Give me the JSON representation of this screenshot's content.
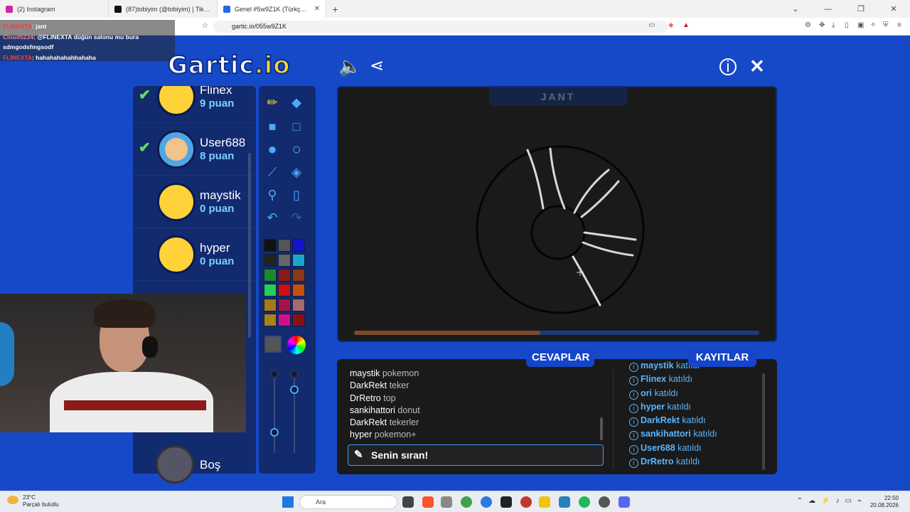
{
  "browser": {
    "tabs": [
      {
        "title": "(2) Instagram",
        "color": "#d6249f"
      },
      {
        "title": "(87)tobiyim (@tobiyim) | TikTok",
        "color": "#111111"
      },
      {
        "title": "Genel #5w9Z1K (Türkçe) - Gartic",
        "color": "#1f6ae0",
        "active": true
      }
    ],
    "url": "gartic.io/055w9Z1K"
  },
  "stream_chat": [
    {
      "user": "FLINEXTA",
      "text": ": jant"
    },
    {
      "user": "Cloud5234",
      "text": ": @FLINEXTA düğün salonu mu bura"
    },
    {
      "user": "",
      "text": "sdmgodsfmgsodf"
    },
    {
      "user": "FLINEXTA",
      "text": ": hahahahahahhahaha"
    }
  ],
  "logo": {
    "main": "Gartic",
    "suffix": ".io"
  },
  "players": [
    {
      "name": "Flinex",
      "points": "9 puan",
      "checked": true
    },
    {
      "name": "User688",
      "points": "8 puan",
      "checked": true
    },
    {
      "name": "maystik",
      "points": "0 puan",
      "checked": false
    },
    {
      "name": "hyper",
      "points": "0 puan",
      "checked": false
    }
  ],
  "empty_slot": {
    "label": "Boş"
  },
  "palette": [
    "#111111",
    "#555555",
    "#1414c8",
    "#222222",
    "#666666",
    "#1ba6c9",
    "#1b8a2e",
    "#8b1a1a",
    "#8b3a14",
    "#22d05a",
    "#d01010",
    "#c8500a",
    "#a87818",
    "#a8104a",
    "#a86a6a",
    "#a88418",
    "#d0108a",
    "#8b1010"
  ],
  "canvas": {
    "hidden_word": "JANT",
    "progress": 0.46
  },
  "answers": {
    "header": "CEVAPLAR",
    "items": [
      {
        "user": "maystik",
        "text": "pokemon"
      },
      {
        "user": "DarkRekt",
        "text": "teker"
      },
      {
        "user": "DrRetro",
        "text": "top"
      },
      {
        "user": "sankihattori",
        "text": "donut"
      },
      {
        "user": "DarkRekt",
        "text": "tekerler"
      },
      {
        "user": "hyper",
        "text": "pokemon+"
      }
    ],
    "input_text": "Senin sıran!"
  },
  "logs": {
    "header": "KAYITLAR",
    "items": [
      {
        "user": "maystik",
        "text": "katıldı"
      },
      {
        "user": "Flinex",
        "text": "katıldı"
      },
      {
        "user": "ori",
        "text": "katıldı"
      },
      {
        "user": "hyper",
        "text": "katıldı"
      },
      {
        "user": "DarkRekt",
        "text": "katıldı"
      },
      {
        "user": "sankihattori",
        "text": "katıldı"
      },
      {
        "user": "User688",
        "text": "katıldı"
      },
      {
        "user": "DrRetro",
        "text": "katıldı"
      }
    ]
  },
  "taskbar": {
    "temp": "23°C",
    "weather": "Parçalı bulutlu",
    "search_placeholder": "Ara",
    "time": "22:50",
    "date": "20.08.2026"
  }
}
